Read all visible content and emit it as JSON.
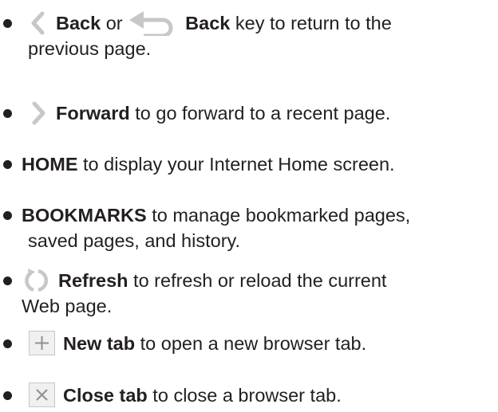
{
  "items": [
    {
      "icon1": "chevron-left-icon",
      "bold1": "Back",
      "mid": " or ",
      "icon2": "return-arrow-icon",
      "bold2": "Back",
      "rest": " key to return to the",
      "line2": "previous page."
    },
    {
      "icon": "chevron-right-icon",
      "bold": "Forward",
      "rest": " to go forward to a recent page."
    },
    {
      "bold": "HOME",
      "rest": " to display your Internet Home screen."
    },
    {
      "bold": "BOOKMARKS",
      "rest": " to manage bookmarked pages,",
      "line2": "saved pages, and history."
    },
    {
      "icon": "refresh-icon",
      "bold": "Refresh",
      "rest": " to refresh or reload the current",
      "line2": "Web page."
    },
    {
      "icon": "plus-icon",
      "bold": "New tab",
      "rest": " to open a new browser tab."
    },
    {
      "icon": "close-icon",
      "bold": "Close tab",
      "rest": " to close a browser tab."
    }
  ],
  "colors": {
    "text": "#231f20",
    "icon_gray": "#c7c7c7",
    "icon_box_bg": "#f0f0f0"
  }
}
